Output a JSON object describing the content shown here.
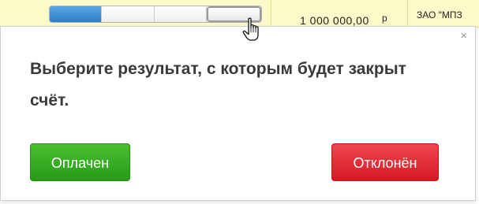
{
  "background_row": {
    "amount": "1 000 000,00",
    "currency": "р",
    "company": "ЗАО \"МПЗ",
    "stage_progress": {
      "segments_total": 4,
      "segments_done": 1,
      "hovered_segment": 4
    }
  },
  "dialog": {
    "close_glyph": "×",
    "message": "Выберите результат, с которым будет закрыт счёт.",
    "buttons": {
      "paid_label": "Оплачен",
      "reject_label": "Отклонён"
    }
  },
  "colors": {
    "row_highlight": "#fdf9c8",
    "progress_done": "#3b8ad3",
    "paid_button": "#2fa81f",
    "reject_button": "#e21f2b"
  },
  "icons": {
    "cursor": "hand-pointer-icon",
    "close": "close-icon"
  }
}
